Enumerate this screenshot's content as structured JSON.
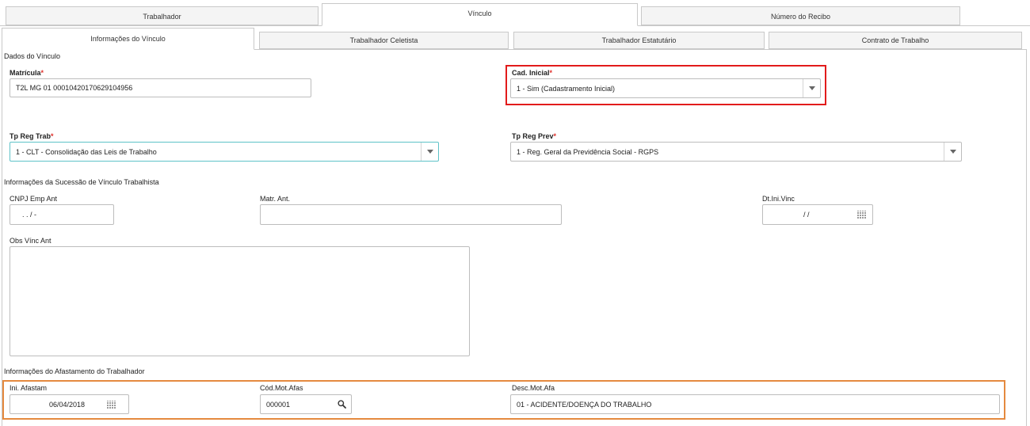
{
  "tabs": {
    "top": [
      "Trabalhador",
      "Vínculo",
      "Número do Recibo"
    ],
    "sub": [
      "Informações do Vínculo",
      "Trabalhador Celetista",
      "Trabalhador Estatutário",
      "Contrato de Trabalho"
    ]
  },
  "dados_vinculo": {
    "title": "Dados do Vínculo",
    "matricula": {
      "label": "Matrícula",
      "required": "*",
      "value": "T2L MG 01 00010420170629104956"
    },
    "cad_inicial": {
      "label": "Cad. Inicial",
      "required": "*",
      "value": "1 - Sim (Cadastramento Inicial)"
    },
    "tp_reg_trab": {
      "label": "Tp Reg Trab",
      "required": "*",
      "value": "1 - CLT - Consolidação das Leis de Trabalho"
    },
    "tp_reg_prev": {
      "label": "Tp Reg Prev",
      "required": "*",
      "value": "1 - Reg. Geral da Previdência Social - RGPS"
    }
  },
  "sucessao": {
    "title": "Informações da Sucessão de Vínculo Trabalhista",
    "cnpj": {
      "label": "CNPJ Emp Ant",
      "value": ".  .  /  -"
    },
    "matr_ant": {
      "label": "Matr. Ant.",
      "value": ""
    },
    "dt_ini_vinc": {
      "label": "Dt.Ini.Vinc",
      "value": "/ /"
    },
    "obs": {
      "label": "Obs Vínc Ant",
      "value": ""
    }
  },
  "afastamento": {
    "title": "Informações do Afastamento do Trabalhador",
    "ini_afastam": {
      "label": "Ini. Afastam",
      "value": "06/04/2018"
    },
    "cod_mot": {
      "label": "Cód.Mot.Afas",
      "value": "000001"
    },
    "desc_mot": {
      "label": "Desc.Mot.Afa",
      "value": "01 - ACIDENTE/DOENÇA DO TRABALHO"
    }
  },
  "colors": {
    "required": "#e0302b",
    "highlight_red": "#e21b1b",
    "highlight_orange": "#e58a3f",
    "focus_border": "#5ec2c8"
  },
  "icons": {
    "dropdown": "chevron-down-icon",
    "calendar": "calendar-icon",
    "search": "search-icon"
  }
}
